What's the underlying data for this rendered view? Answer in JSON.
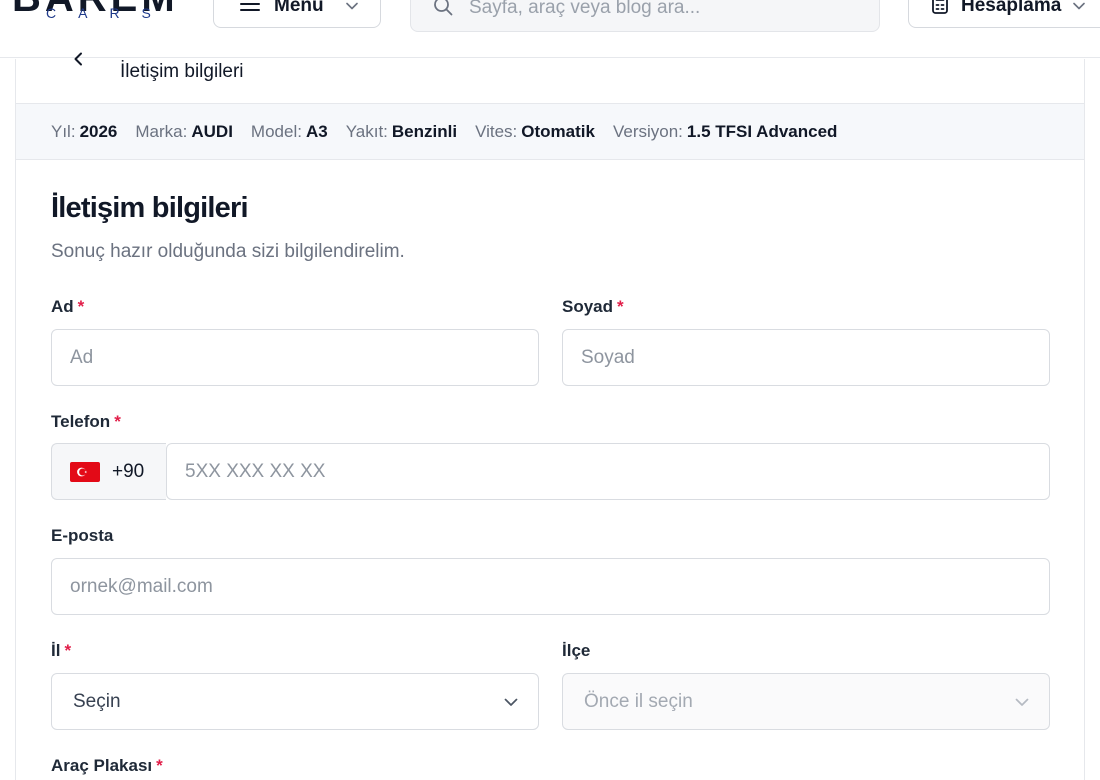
{
  "header": {
    "logo_main": "BAREM",
    "logo_sub": "CARS",
    "menu_label": "Menu",
    "search_placeholder": "Sayfa, araç veya blog ara...",
    "calc_label": "Hesaplama"
  },
  "card": {
    "title": "İletişim bilgileri",
    "specs": [
      {
        "label": "Yıl:",
        "value": "2026"
      },
      {
        "label": "Marka:",
        "value": "AUDI"
      },
      {
        "label": "Model:",
        "value": "A3"
      },
      {
        "label": "Yakıt:",
        "value": "Benzinli"
      },
      {
        "label": "Vites:",
        "value": "Otomatik"
      },
      {
        "label": "Versiyon:",
        "value": "1.5 TFSI Advanced"
      }
    ]
  },
  "form": {
    "title": "İletişim bilgileri",
    "subtitle": "Sonuç hazır olduğunda sizi bilgilendirelim.",
    "required_mark": "*",
    "first_name": {
      "label": "Ad",
      "placeholder": "Ad"
    },
    "last_name": {
      "label": "Soyad",
      "placeholder": "Soyad"
    },
    "phone": {
      "label": "Telefon",
      "country_code": "+90",
      "placeholder": "5XX XXX XX XX"
    },
    "email": {
      "label": "E-posta",
      "placeholder": "ornek@mail.com"
    },
    "city": {
      "label": "İl",
      "value": "Seçin"
    },
    "district": {
      "label": "İlçe",
      "value": "Önce il seçin"
    },
    "plate": {
      "label": "Araç Plakası"
    }
  },
  "colors": {
    "required": "#e11d48",
    "flag": "#e30a17",
    "spec_bar": "#f6f8fb",
    "logo_sub": "#1f3a8a"
  },
  "icons": [
    "hamburger-icon",
    "chevron-down-icon",
    "search-icon",
    "calculator-icon",
    "back-arrow-icon",
    "turkey-flag-icon"
  ]
}
